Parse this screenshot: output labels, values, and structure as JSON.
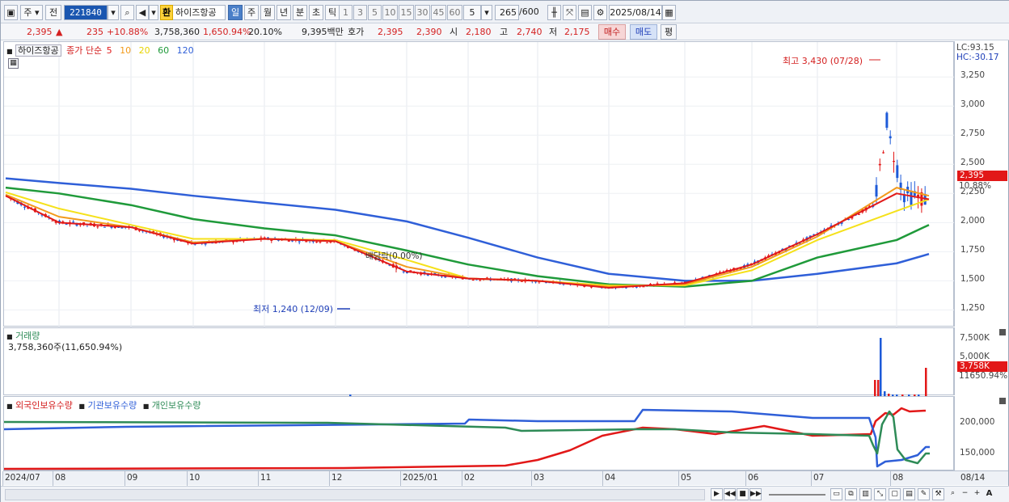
{
  "toolbar": {
    "market_label": "주",
    "prev_label": "전",
    "code": "221840",
    "fx_label": "환",
    "stock_name": "하이즈항공",
    "periods": [
      "일",
      "주",
      "월",
      "년",
      "분",
      "초",
      "틱"
    ],
    "period_active": "일",
    "intervals": [
      "1",
      "3",
      "5",
      "10",
      "15",
      "30",
      "45",
      "60"
    ],
    "interval_value": "5",
    "count": "265",
    "count_max": "/600",
    "date": "2025/08/14"
  },
  "quote": {
    "price": "2,395",
    "change_arrow": "▲",
    "change": "235",
    "change_pct": "+10.88%",
    "volume": "3,758,360",
    "volume_ratio": "1,650.94%",
    "turnover": "20.10%",
    "amount": "9,395백만",
    "hoga_label": "호가",
    "ask": "2,395",
    "bid": "2,390",
    "open_label": "시",
    "open": "2,180",
    "high_label": "고",
    "high": "2,740",
    "low_label": "저",
    "low": "2,175",
    "buy_label": "매수",
    "sell_label": "매도",
    "eval_label": "평"
  },
  "price_panel": {
    "name": "하이즈항공",
    "ma_label": "종가 단순",
    "ma_periods": [
      "5",
      "10",
      "20",
      "60",
      "120"
    ],
    "lc": "LC:93.15",
    "hc": "HC:-30.17",
    "y_ticks": [
      "3,250",
      "3,000",
      "2,750",
      "2,500",
      "2,250",
      "2,000",
      "1,750",
      "1,500",
      "1,250"
    ],
    "last_price": "2,395",
    "last_pct": "10.88%",
    "high_annotation": "최고 3,430 (07/28)",
    "low_annotation": "최저 1,240 (12/09)",
    "event_annotation": "배당락(0.00%)"
  },
  "volume_panel": {
    "title": "거래량",
    "value": "3,758,360주(11,650.94%)",
    "y_ticks": [
      "7,500K",
      "5,000K"
    ],
    "last_value": "3,758K",
    "last_pct": "11650.94%"
  },
  "holding_panel": {
    "legend": [
      "외국인보유수량",
      "기관보유수량",
      "개인보유수량"
    ],
    "y_ticks": [
      "200,000",
      "150,000"
    ]
  },
  "x_axis": {
    "labels": [
      "2024/07",
      "08",
      "09",
      "10",
      "11",
      "12",
      "2025/01",
      "02",
      "03",
      "04",
      "05",
      "06",
      "07",
      "08",
      "08/14"
    ]
  },
  "colors": {
    "up": "#e21818",
    "down": "#1d5ad8",
    "ma5": "#e11a1a",
    "ma10": "#f29a1b",
    "ma20": "#f5e11a",
    "ma60": "#1f9a3a",
    "ma120": "#2f5fd8",
    "foreign": "#e21818",
    "institution": "#2f5fd8",
    "individual": "#2e8b57"
  },
  "chart_data": {
    "type": "line",
    "title": "하이즈항공",
    "xlabel": "",
    "ylabel": "",
    "x": [
      "2024/07",
      "08",
      "09",
      "10",
      "11",
      "12",
      "2025/01",
      "02",
      "03",
      "04",
      "05",
      "06",
      "07",
      "08",
      "08/14"
    ],
    "ylim": [
      1100,
      3550
    ],
    "series": [
      {
        "name": "5",
        "values": [
          2230,
          2000,
          1960,
          1820,
          1860,
          1840,
          1580,
          1520,
          1500,
          1440,
          1480,
          1640,
          1900,
          2250,
          2200
        ]
      },
      {
        "name": "10",
        "values": [
          2240,
          2050,
          1960,
          1830,
          1860,
          1840,
          1620,
          1520,
          1500,
          1450,
          1470,
          1620,
          1880,
          2300,
          2230
        ]
      },
      {
        "name": "20",
        "values": [
          2260,
          2120,
          1980,
          1860,
          1860,
          1850,
          1680,
          1520,
          1500,
          1460,
          1460,
          1590,
          1850,
          2100,
          2200
        ]
      },
      {
        "name": "60",
        "values": [
          2300,
          2250,
          2150,
          2030,
          1950,
          1890,
          1760,
          1640,
          1540,
          1470,
          1450,
          1500,
          1700,
          1850,
          1980
        ]
      },
      {
        "name": "120",
        "values": [
          2380,
          2340,
          2290,
          2230,
          2170,
          2110,
          2010,
          1870,
          1700,
          1560,
          1500,
          1500,
          1560,
          1650,
          1730
        ]
      }
    ],
    "annotations": [
      "최고 3,430 (07/28)",
      "최저 1,240 (12/09)",
      "배당락(0.00%)"
    ]
  }
}
